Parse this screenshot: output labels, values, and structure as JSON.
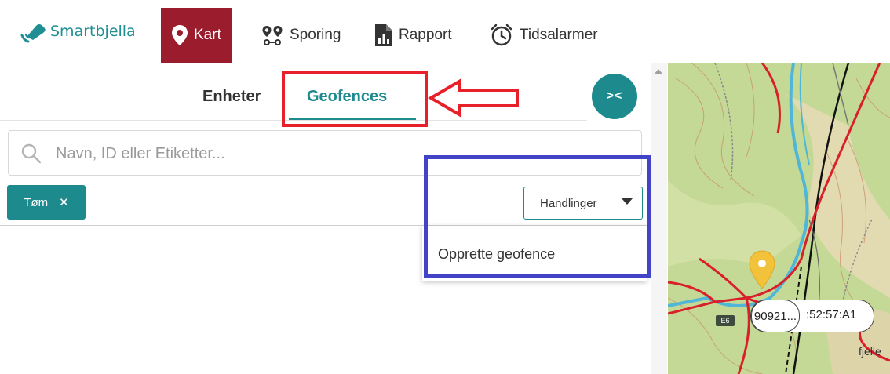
{
  "brand": {
    "name": "Smartbjella"
  },
  "nav": {
    "items": [
      {
        "label": "Kart",
        "icon": "map-pin-icon",
        "active": true
      },
      {
        "label": "Sporing",
        "icon": "tracking-icon",
        "active": false
      },
      {
        "label": "Rapport",
        "icon": "report-icon",
        "active": false
      },
      {
        "label": "Tidsalarmer",
        "icon": "alarm-clock-icon",
        "active": false
      }
    ]
  },
  "panel": {
    "tabs": [
      {
        "label": "Enheter",
        "selected": false
      },
      {
        "label": "Geofences",
        "selected": true
      }
    ],
    "collapse_label": "><",
    "search": {
      "placeholder": "Navn, ID eller Etiketter...",
      "value": ""
    },
    "filter_chip": {
      "label": "Tøm",
      "close": "✕"
    },
    "actions": {
      "label": "Handlinger",
      "menu": [
        {
          "label": "Opprette geofence"
        }
      ]
    }
  },
  "map": {
    "marker_label_left": "90921...",
    "marker_label_right": ":52:57:A1",
    "road_shield": "E6",
    "place_name": "fjelle"
  },
  "colors": {
    "accent": "#1d8a8e",
    "nav_active": "#9b1c2c",
    "annotation_red": "#e8202a",
    "annotation_blue": "#4343c8",
    "marker": "#f2c23a"
  }
}
